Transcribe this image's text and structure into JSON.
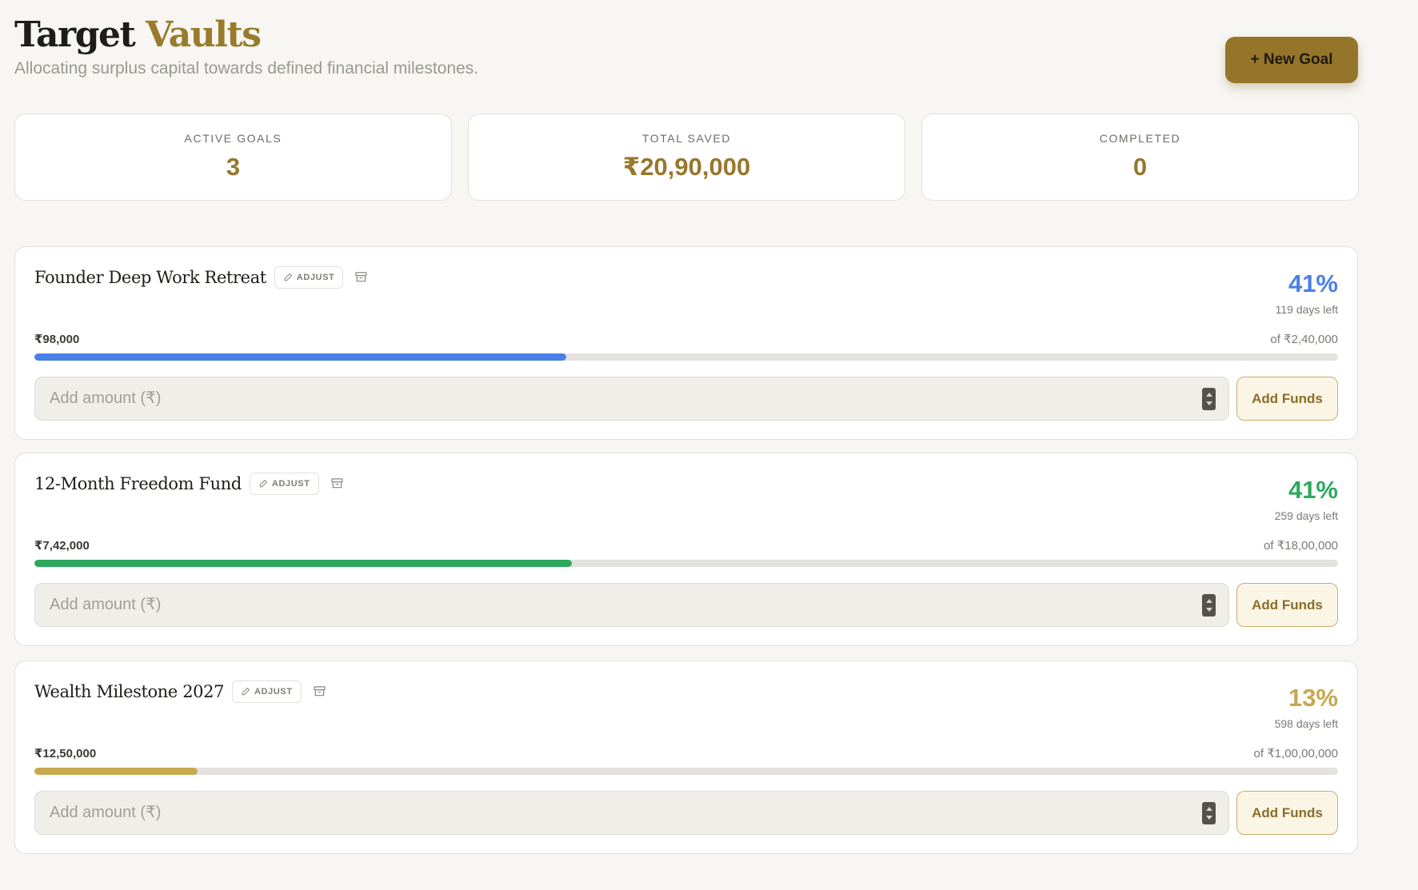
{
  "header": {
    "title_main": "Target",
    "title_accent": "Vaults",
    "subtitle": "Allocating surplus capital towards defined financial milestones.",
    "new_goal_label": "+ New Goal"
  },
  "stats": [
    {
      "label": "ACTIVE GOALS",
      "value": "3"
    },
    {
      "label": "TOTAL SAVED",
      "value": "₹20,90,000"
    },
    {
      "label": "COMPLETED",
      "value": "0"
    }
  ],
  "goal_common": {
    "adjust_label": "ADJUST",
    "amount_placeholder": "Add amount (₹)",
    "add_funds_label": "Add Funds"
  },
  "goals": [
    {
      "name": "Founder Deep Work Retreat",
      "percent": "41%",
      "days_left": "119 days left",
      "saved": "₹98,000",
      "target": "of ₹2,40,000",
      "progress": 0.408,
      "color": "#4a7fe6"
    },
    {
      "name": "12-Month Freedom Fund",
      "percent": "41%",
      "days_left": "259 days left",
      "saved": "₹7,42,000",
      "target": "of ₹18,00,000",
      "progress": 0.412,
      "color": "#2ea85f"
    },
    {
      "name": "Wealth Milestone 2027",
      "percent": "13%",
      "days_left": "598 days left",
      "saved": "₹12,50,000",
      "target": "of ₹1,00,00,000",
      "progress": 0.125,
      "color": "#c7a84f"
    }
  ]
}
